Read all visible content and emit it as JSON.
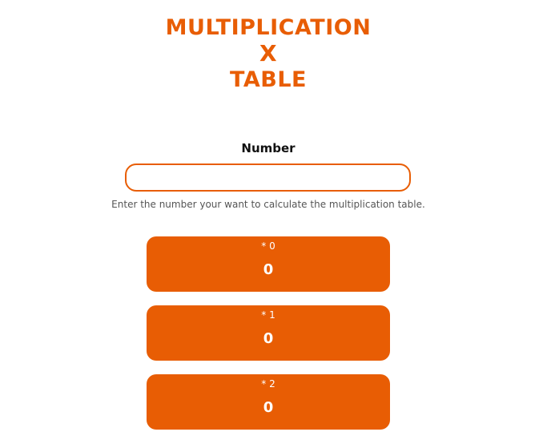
{
  "header": {
    "title_line1": "MULTIPLICATION",
    "title_line2": "X",
    "title_line3": "TABLE"
  },
  "form": {
    "label": "Number",
    "input_value": "",
    "helper_text": "Enter the number your want to calculate the multiplication table."
  },
  "results": [
    {
      "multiplier": "* 0",
      "value": "0"
    },
    {
      "multiplier": "* 1",
      "value": "0"
    },
    {
      "multiplier": "* 2",
      "value": "0"
    }
  ],
  "colors": {
    "accent": "#e85d04"
  }
}
